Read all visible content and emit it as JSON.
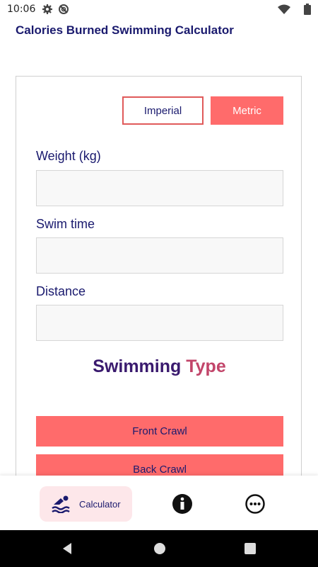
{
  "status_bar": {
    "time": "10:06",
    "icons": [
      "gear-icon",
      "data-saver-icon",
      "wifi-icon",
      "battery-icon"
    ]
  },
  "app": {
    "title": "Calories Burned Swimming Calculator"
  },
  "units": {
    "imperial_label": "Imperial",
    "metric_label": "Metric",
    "selected": "Metric",
    "accent_color": "#ff6b6b"
  },
  "form": {
    "weight_label": "Weight (kg)",
    "weight_value": "",
    "time_label": "Swim time",
    "time_value": "",
    "distance_label": "Distance",
    "distance_value": ""
  },
  "swimming_type": {
    "heading_word1": "Swimming",
    "heading_word2": "Type",
    "options": [
      "Front Crawl",
      "Back Crawl"
    ]
  },
  "bottom_nav": {
    "calculator_label": "Calculator",
    "items": [
      "calculator-icon",
      "info-icon",
      "more-icon"
    ]
  },
  "colors": {
    "primary_text": "#1a1a6e",
    "button_fill": "#ff6b6b",
    "heading_gradient": [
      "#3a1a6e",
      "#c2456a"
    ]
  }
}
